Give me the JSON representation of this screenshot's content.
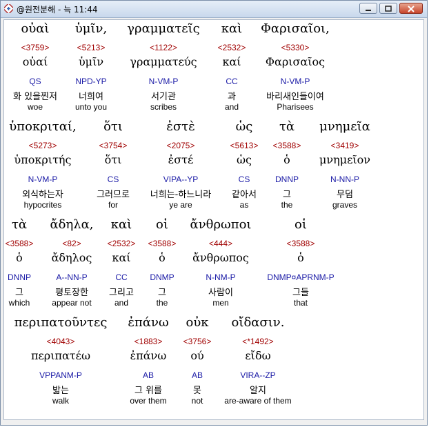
{
  "window": {
    "title": "@원전분해 - 늑 11:44"
  },
  "lines": [
    {
      "words": [
        {
          "greek": "οὐαὶ",
          "num": "<3759>",
          "lemma": "οὐαί",
          "pos": "QS",
          "korean": "화 있을찐저",
          "english": "woe"
        },
        {
          "greek": "ὑμῖν,",
          "num": "<5213>",
          "lemma": "ὑμῖν",
          "pos": "NPD-YP",
          "korean": "너희여",
          "english": "unto you"
        },
        {
          "greek": "γραμματεῖς",
          "num": "<1122>",
          "lemma": "γραμματεύς",
          "pos": "N-VM-P",
          "korean": "서기관",
          "english": "scribes"
        },
        {
          "greek": "καὶ",
          "num": "<2532>",
          "lemma": "καί",
          "pos": "CC",
          "korean": "과",
          "english": "and"
        },
        {
          "greek": "Φαρισαῖοι,",
          "num": "<5330>",
          "lemma": "Φαρισαῖος",
          "pos": "N-VM-P",
          "korean": "바리새인들이여",
          "english": "Pharisees"
        }
      ]
    },
    {
      "words": [
        {
          "greek": "ὑποκριταί,",
          "num": "<5273>",
          "lemma": "ὑποκριτής",
          "pos": "N-VM-P",
          "korean": "외식하는자",
          "english": "hypocrites"
        },
        {
          "greek": "ὅτι",
          "num": "<3754>",
          "lemma": "ὅτι",
          "pos": "CS",
          "korean": "그러므로",
          "english": "for"
        },
        {
          "greek": "ἐστὲ",
          "num": "<2075>",
          "lemma": "ἐστέ",
          "pos": "VIPA--YP",
          "korean": "너희는-하느니라",
          "english": "ye are"
        },
        {
          "greek": "ὡς",
          "num": "<5613>",
          "lemma": "ὡς",
          "pos": "CS",
          "korean": "같아서",
          "english": "as"
        },
        {
          "greek": "τὰ",
          "num": "<3588>",
          "lemma": "ὁ",
          "pos": "DNNP",
          "korean": "그",
          "english": "the"
        },
        {
          "greek": "μνημεῖα",
          "num": "<3419>",
          "lemma": "μνημεῖον",
          "pos": "N-NN-P",
          "korean": "무덤",
          "english": "graves"
        }
      ]
    },
    {
      "words": [
        {
          "greek": "τὰ",
          "num": "<3588>",
          "lemma": "ὁ",
          "pos": "DNNP",
          "korean": "그",
          "english": "which"
        },
        {
          "greek": "ἄδηλα,",
          "num": "<82>",
          "lemma": "ἄδηλος",
          "pos": "A--NN-P",
          "korean": "평토장한",
          "english": "appear not"
        },
        {
          "greek": "καὶ",
          "num": "<2532>",
          "lemma": "καί",
          "pos": "CC",
          "korean": "그리고",
          "english": "and"
        },
        {
          "greek": "οἱ",
          "num": "<3588>",
          "lemma": "ὁ",
          "pos": "DNMP",
          "korean": "그",
          "english": "the"
        },
        {
          "greek": "ἄνθρωποι",
          "num": "<444>",
          "lemma": "ἄνθρωπος",
          "pos": "N-NM-P",
          "korean": "사람이",
          "english": "men"
        },
        {
          "greek": "οἱ",
          "num": "<3588>",
          "lemma": "ὁ",
          "pos": "DNMP¤APRNM-P",
          "korean": "그들",
          "english": "that"
        }
      ]
    },
    {
      "words": [
        {
          "greek": "περιπατοῦντες",
          "num": "<4043>",
          "lemma": "περιπατέω",
          "pos": "VPPANM-P",
          "korean": "밟는",
          "english": "walk"
        },
        {
          "greek": "ἐπάνω",
          "num": "<1883>",
          "lemma": "ἐπάνω",
          "pos": "AB",
          "korean": "그 위를",
          "english": "over them"
        },
        {
          "greek": "οὐκ",
          "num": "<3756>",
          "lemma": "ού",
          "pos": "AB",
          "korean": "못",
          "english": "not"
        },
        {
          "greek": "οἴδασιν.",
          "num": "<*1492>",
          "lemma": "εἴδω",
          "pos": "VIRA--ZP",
          "korean": "알지",
          "english": "are-aware of them"
        }
      ]
    }
  ]
}
